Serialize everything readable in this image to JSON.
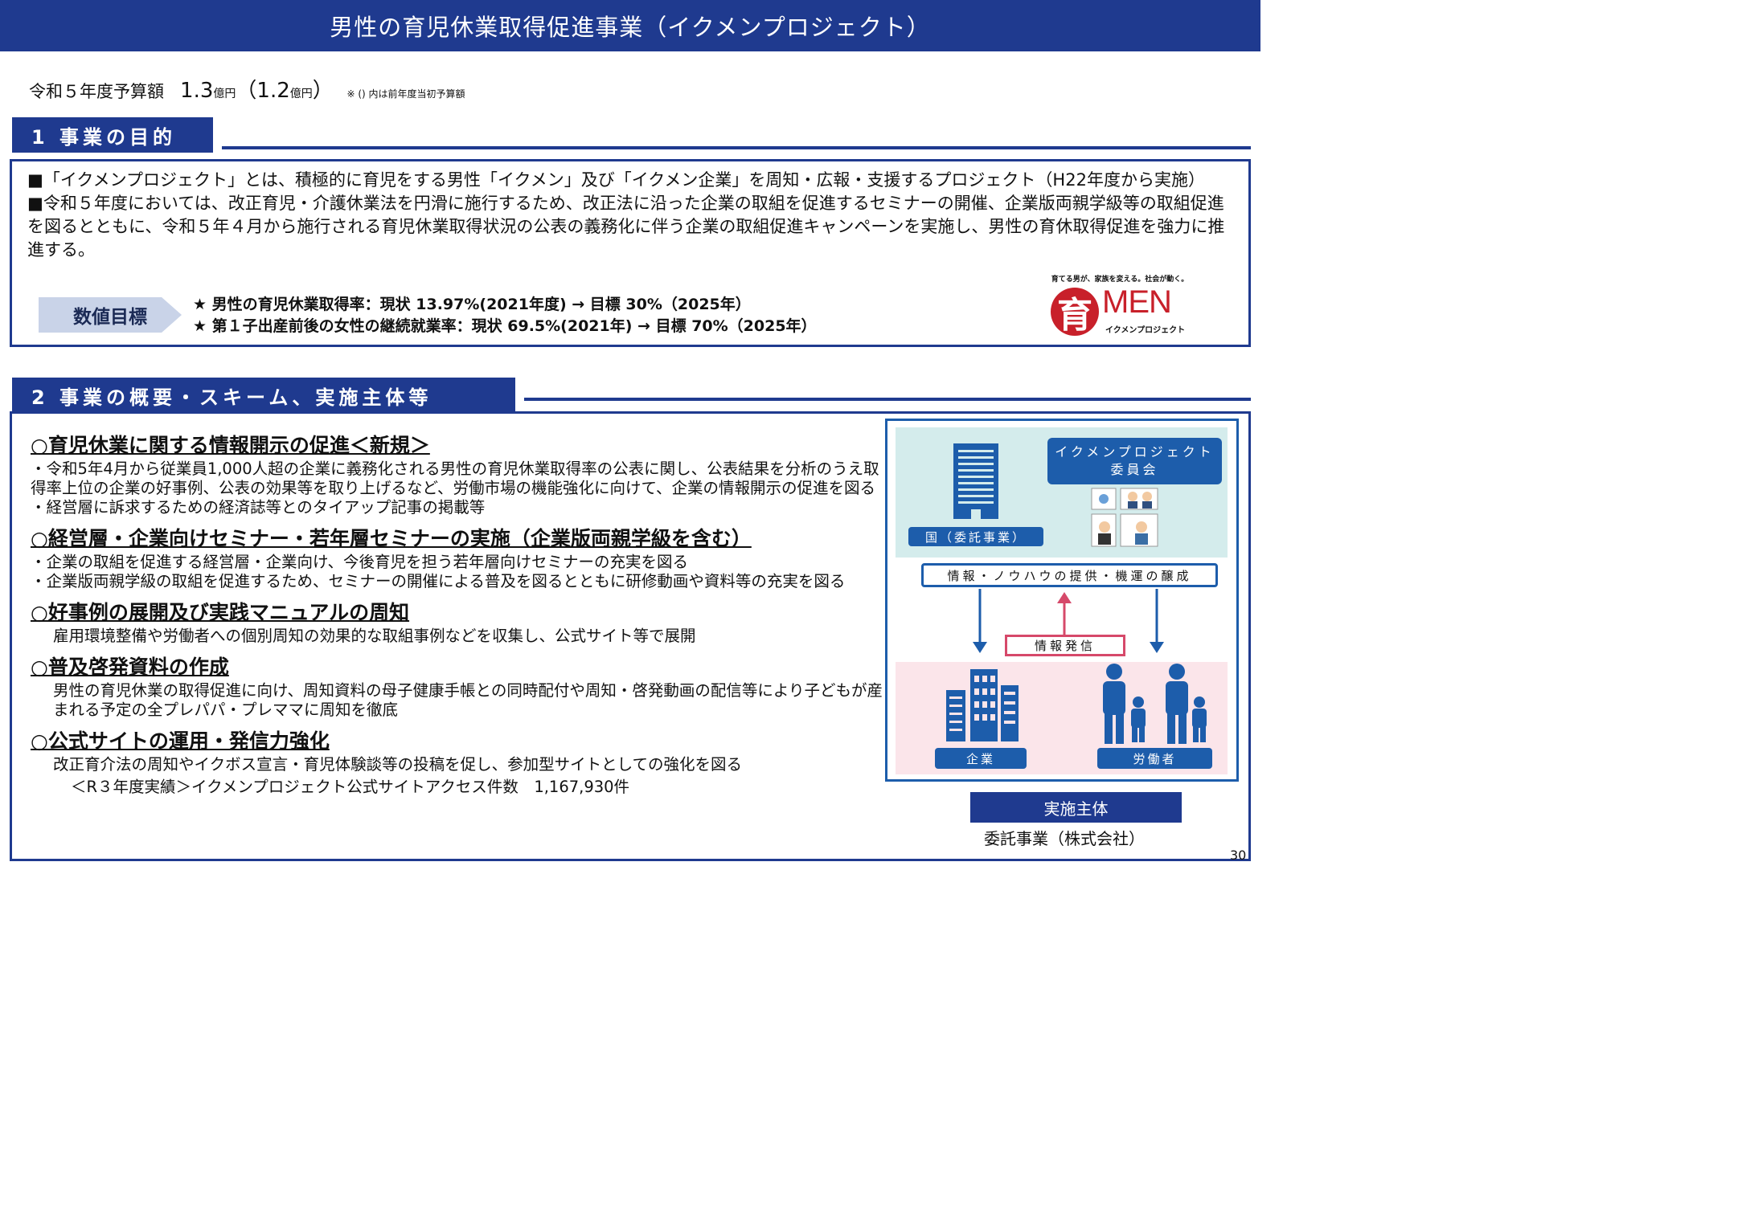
{
  "title": "男性の育児休業取得促進事業（イクメンプロジェクト）",
  "budget": {
    "prefix": "令和５年度予算額",
    "amount": "1.3",
    "unit": "億円",
    "prev_open": "（",
    "prev_amount": "1.2",
    "prev_unit": "億円",
    "prev_close": "）",
    "note": "※ () 内は前年度当初予算額"
  },
  "section1": {
    "heading": "1 事業の目的",
    "paragraphs": [
      "■「イクメンプロジェクト」とは、積極的に育児をする男性「イクメン」及び「イクメン企業」を周知・広報・支援するプロジェクト（H22年度から実施）",
      "■令和５年度においては、改正育児・介護休業法を円滑に施行するため、改正法に沿った企業の取組を促進するセミナーの開催、企業版両親学級等の取組促進を図るとともに、令和５年４月から施行される育児休業取得状況の公表の義務化に伴う企業の取組促進キャンペーンを実施し、男性の育休取得促進を強力に推進する。"
    ],
    "target_label": "数値目標",
    "targets": [
      "★ 男性の育児休業取得率：現状 13.97%(2021年度) → 目標 30%（2025年）",
      "★ 第１子出産前後の女性の継続就業率：現状 69.5%(2021年) → 目標 70%（2025年）"
    ],
    "logo": {
      "tagline": "育てる男が、家族を変える。社会が動く。",
      "kanji": "育",
      "word": "MEN",
      "sub": "イクメンプロジェクト"
    }
  },
  "section2": {
    "heading": "2 事業の概要・スキーム、実施主体等",
    "items": [
      {
        "heading": "○育児休業に関する情報開示の促進＜新規＞",
        "lines": [
          "・令和5年4月から従業員1,000人超の企業に義務化される男性の育児休業取得率の公表に関し、公表結果を分析のうえ取得率上位の企業の好事例、公表の効果等を取り上げるなど、労働市場の機能強化に向けて、企業の情報開示の促進を図る",
          "・経営層に訴求するための経済誌等とのタイアップ記事の掲載等"
        ]
      },
      {
        "heading": "○経営層・企業向けセミナー・若年層セミナーの実施（企業版両親学級を含む）",
        "lines": [
          "・企業の取組を促進する経営層・企業向け、今後育児を担う若年層向けセミナーの充実を図る",
          "・企業版両親学級の取組を促進するため、セミナーの開催による普及を図るとともに研修動画や資料等の充実を図る"
        ]
      },
      {
        "heading": "○好事例の展開及び実践マニュアルの周知",
        "lines": [
          "雇用環境整備や労働者への個別周知の効果的な取組事例などを収集し、公式サイト等で展開"
        ]
      },
      {
        "heading": "○普及啓発資料の作成",
        "lines": [
          "男性の育児休業の取得促進に向け、周知資料の母子健康手帳との同時配付や周知・啓発動画の配信等により子どもが産まれる予定の全プレパパ・プレママに周知を徹底"
        ]
      },
      {
        "heading": "○公式サイトの運用・発信力強化",
        "lines": [
          "改正育介法の周知やイクボス宣言・育児体験談等の投稿を促し、参加型サイトとしての強化を図る"
        ]
      }
    ],
    "result": "＜R３年度実績＞イクメンプロジェクト公式サイトアクセス件数　1,167,930件"
  },
  "diagram": {
    "committee_line1": "イクメンプロジェクト",
    "committee_line2": "委員会",
    "gov_label": "国（委託事業）",
    "info_bar": "情報・ノウハウの提供・機運の醸成",
    "send_label": "情報発信",
    "company_label": "企業",
    "worker_label": "労働者",
    "entity_heading": "実施主体",
    "entity_value": "委託事業（株式会社）"
  },
  "page_number": "30",
  "colors": {
    "navy": "#1f3a8f",
    "diagram_blue": "#1d5dab",
    "light_teal": "#d4ecec",
    "light_pink": "#fbe5ea",
    "logo_red": "#c8202a"
  }
}
